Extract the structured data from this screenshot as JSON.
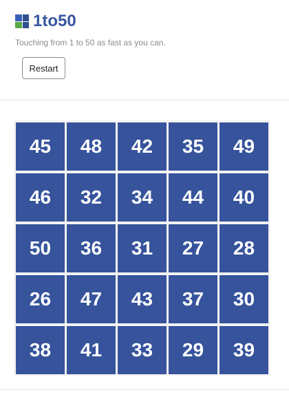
{
  "app": {
    "title": "1to50",
    "subtitle": "Touching from 1 to 50 as fast as you can.",
    "logo_icon": "grid-logo-icon"
  },
  "controls": {
    "restart_label": "Restart"
  },
  "board": {
    "tile_color": "#36539c",
    "text_color": "#ffffff",
    "tiles": [
      [
        "45",
        "48",
        "42",
        "35",
        "49"
      ],
      [
        "46",
        "32",
        "34",
        "44",
        "40"
      ],
      [
        "50",
        "36",
        "31",
        "27",
        "28"
      ],
      [
        "26",
        "47",
        "43",
        "37",
        "30"
      ],
      [
        "38",
        "41",
        "33",
        "29",
        "39"
      ]
    ]
  }
}
